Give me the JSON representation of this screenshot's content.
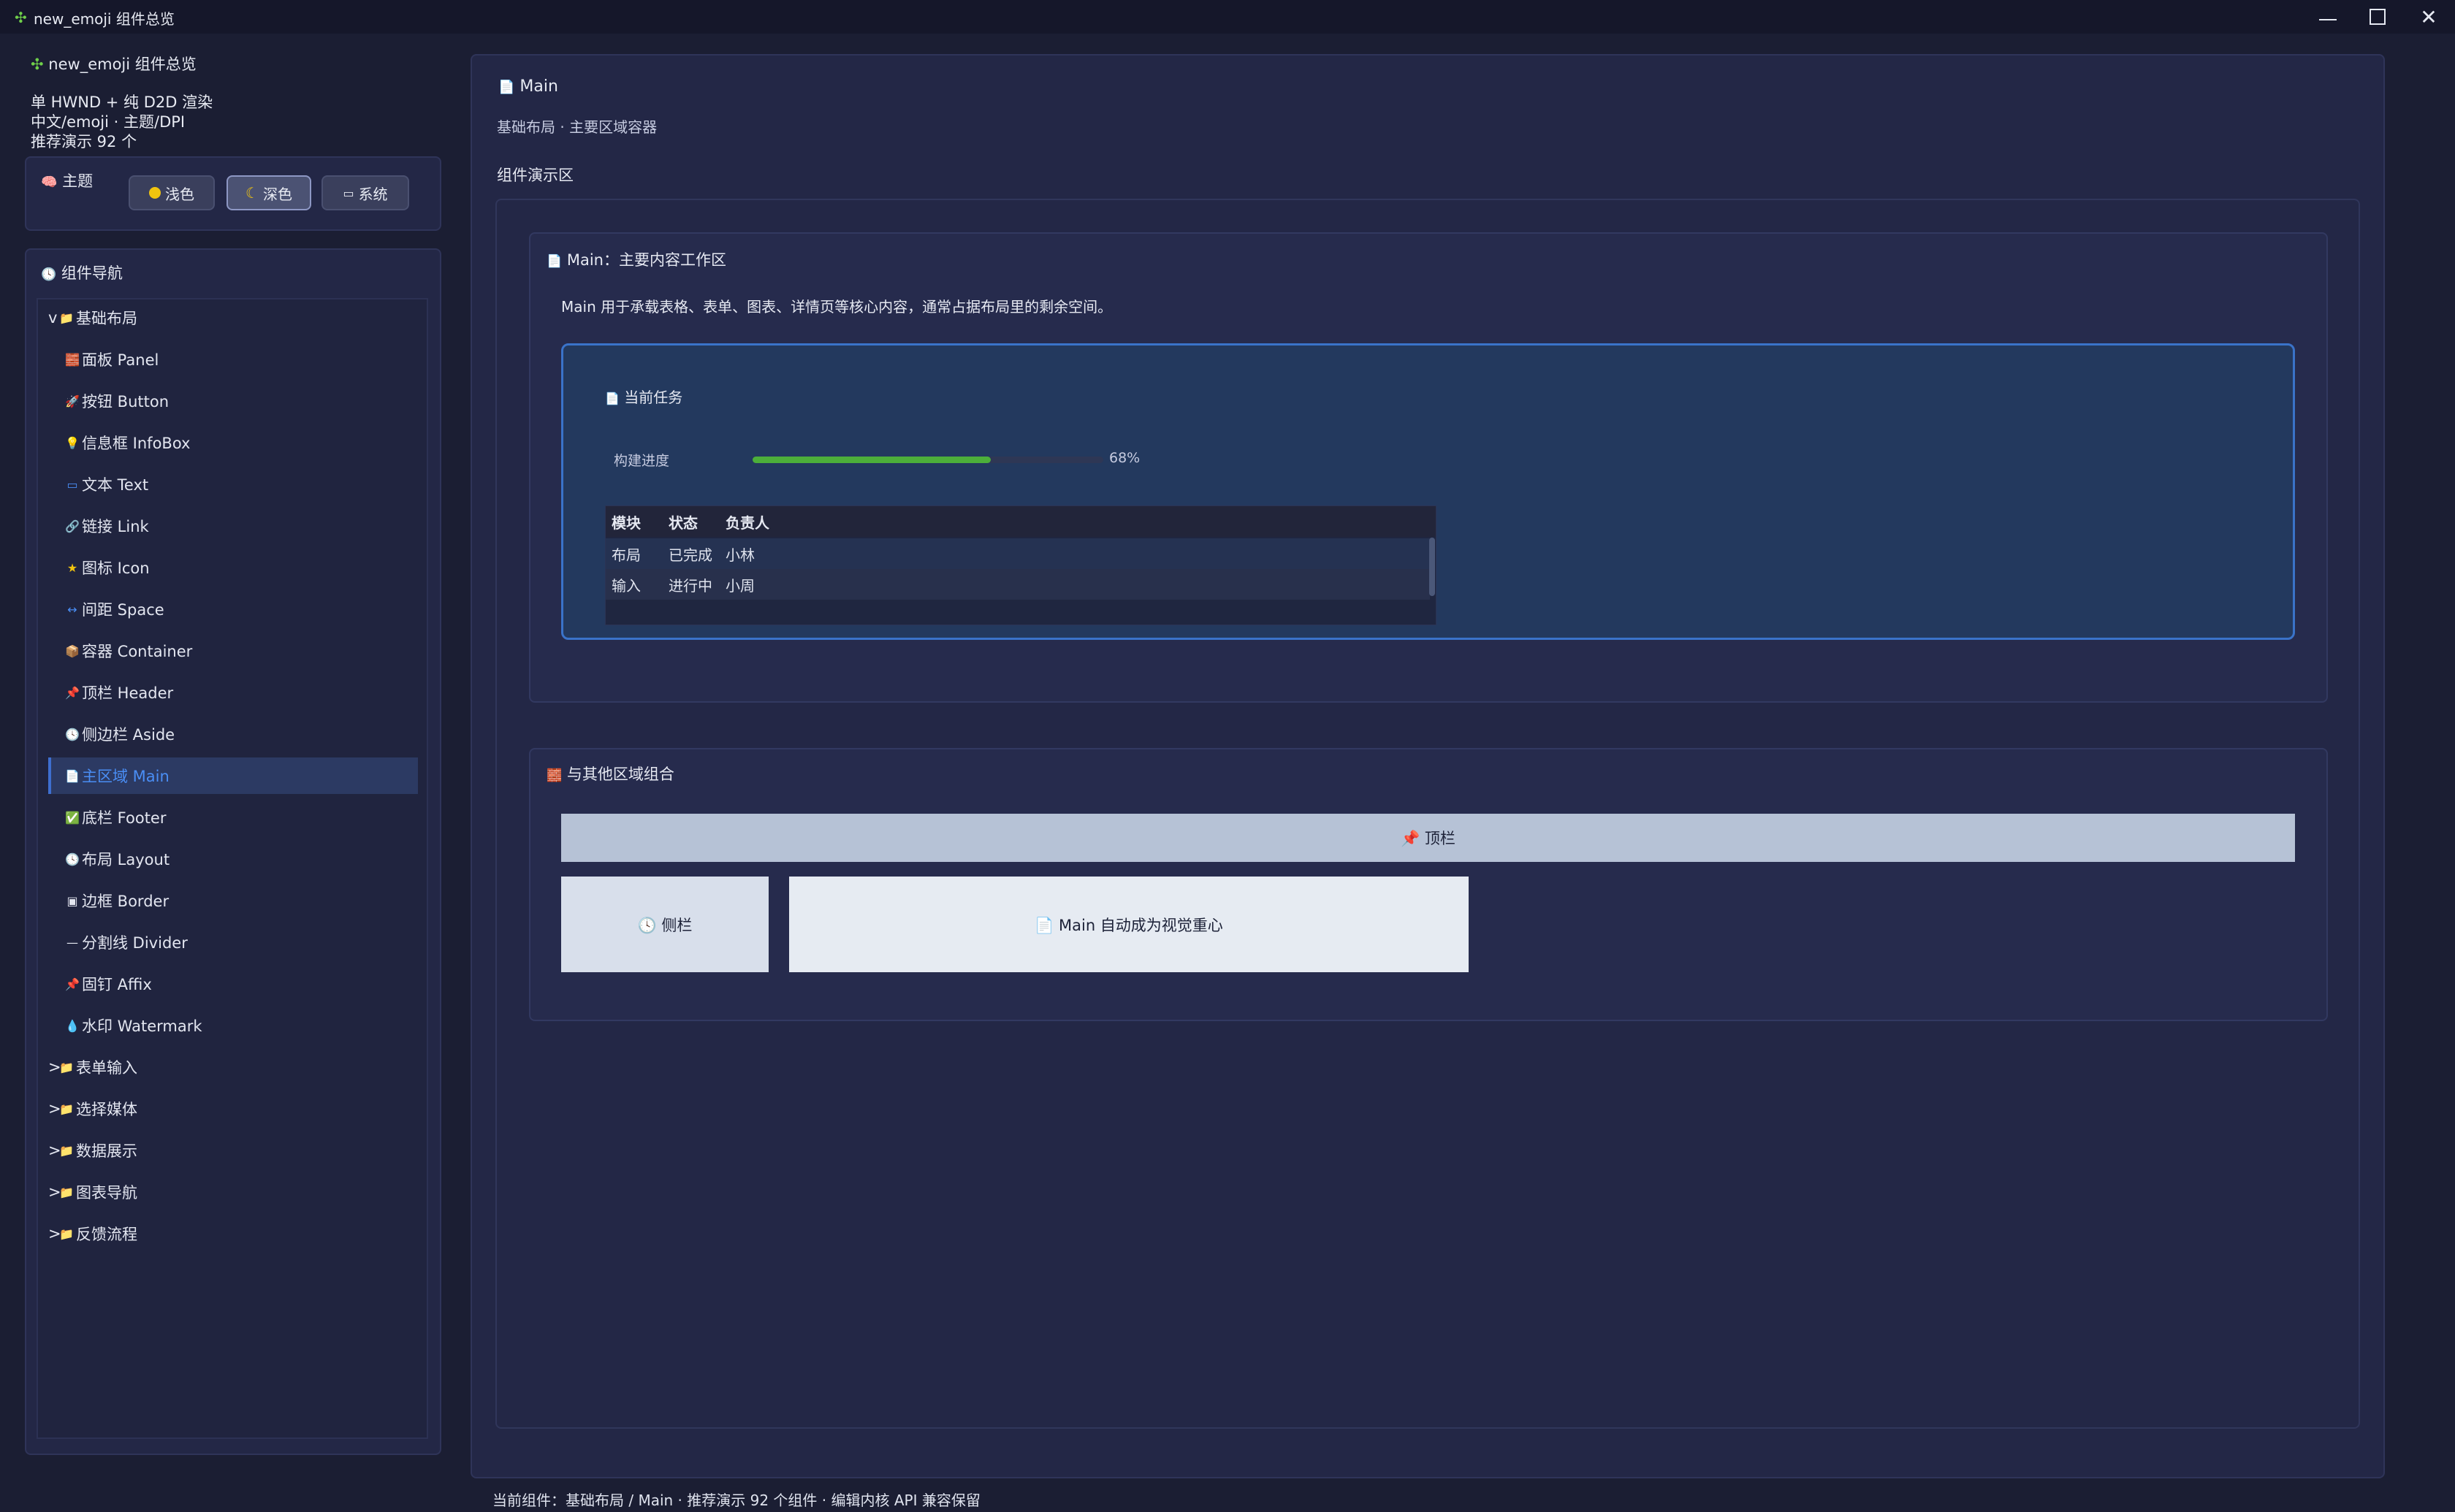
{
  "window": {
    "title": "new_emoji 组件总览",
    "minimize_icon": "minimize-icon",
    "maximize_icon": "maximize-icon",
    "close_icon": "close-icon"
  },
  "sidebar": {
    "app_title": "new_emoji 组件总览",
    "info_lines": [
      "单 HWND + 纯 D2D 渲染",
      "中文/emoji · 主题/DPI",
      "推荐演示 92 个"
    ],
    "theme": {
      "label": "主题",
      "buttons": [
        {
          "label": "浅色",
          "active": false
        },
        {
          "label": "深色",
          "active": true
        },
        {
          "label": "系统",
          "active": false
        }
      ]
    },
    "nav": {
      "title": "组件导航",
      "groups": [
        {
          "label": "基础布局",
          "expanded": true,
          "items": [
            {
              "icon": "🧱",
              "label": "面板 Panel"
            },
            {
              "icon": "🚀",
              "label": "按钮 Button"
            },
            {
              "icon": "💡",
              "label": "信息框 InfoBox"
            },
            {
              "icon": "🔤",
              "label": "文本 Text"
            },
            {
              "icon": "🔗",
              "label": "链接 Link"
            },
            {
              "icon": "⭐",
              "label": "图标 Icon"
            },
            {
              "icon": "↔",
              "label": "间距 Space"
            },
            {
              "icon": "📦",
              "label": "容器 Container"
            },
            {
              "icon": "📌",
              "label": "顶栏 Header"
            },
            {
              "icon": "🕓",
              "label": "侧边栏 Aside"
            },
            {
              "icon": "📄",
              "label": "主区域 Main",
              "active": true
            },
            {
              "icon": "✅",
              "label": "底栏 Footer"
            },
            {
              "icon": "🕓",
              "label": "布局 Layout"
            },
            {
              "icon": "▣",
              "label": "边框 Border"
            },
            {
              "icon": "—",
              "label": "分割线 Divider"
            },
            {
              "icon": "📌",
              "label": "固钉 Affix"
            },
            {
              "icon": "💧",
              "label": "水印 Watermark"
            }
          ]
        },
        {
          "label": "表单输入",
          "expanded": false
        },
        {
          "label": "选择媒体",
          "expanded": false
        },
        {
          "label": "数据展示",
          "expanded": false
        },
        {
          "label": "图表导航",
          "expanded": false
        },
        {
          "label": "反馈流程",
          "expanded": false
        }
      ]
    }
  },
  "main": {
    "title": "Main",
    "subtitle": "基础布局 · 主要区域容器",
    "demo_label": "组件演示区",
    "card1": {
      "title": "Main：主要内容工作区",
      "description": "Main 用于承载表格、表单、图表、详情页等核心内容，通常占据布局里的剩余空间。",
      "task_title": "当前任务",
      "progress_label": "构建进度",
      "progress_value": 0.68,
      "progress_text": "68%",
      "table": {
        "columns": [
          "模块",
          "状态",
          "负责人"
        ],
        "rows": [
          [
            "布局",
            "已完成",
            "小林"
          ],
          [
            "输入",
            "进行中",
            "小周"
          ]
        ]
      }
    },
    "card2": {
      "title": "与其他区域组合",
      "header_label": "📌 顶栏",
      "aside_label": "🕓 侧栏",
      "main_label": "📄 Main 自动成为视觉重心"
    }
  },
  "status_bar": "当前组件：基础布局 / Main · 推荐演示 92 个组件 · 编辑内核 API 兼容保留",
  "colors": {
    "background": "#1b1e33",
    "panel": "#232746",
    "accent": "#3e6fd0",
    "progress": "#4caf3a"
  }
}
